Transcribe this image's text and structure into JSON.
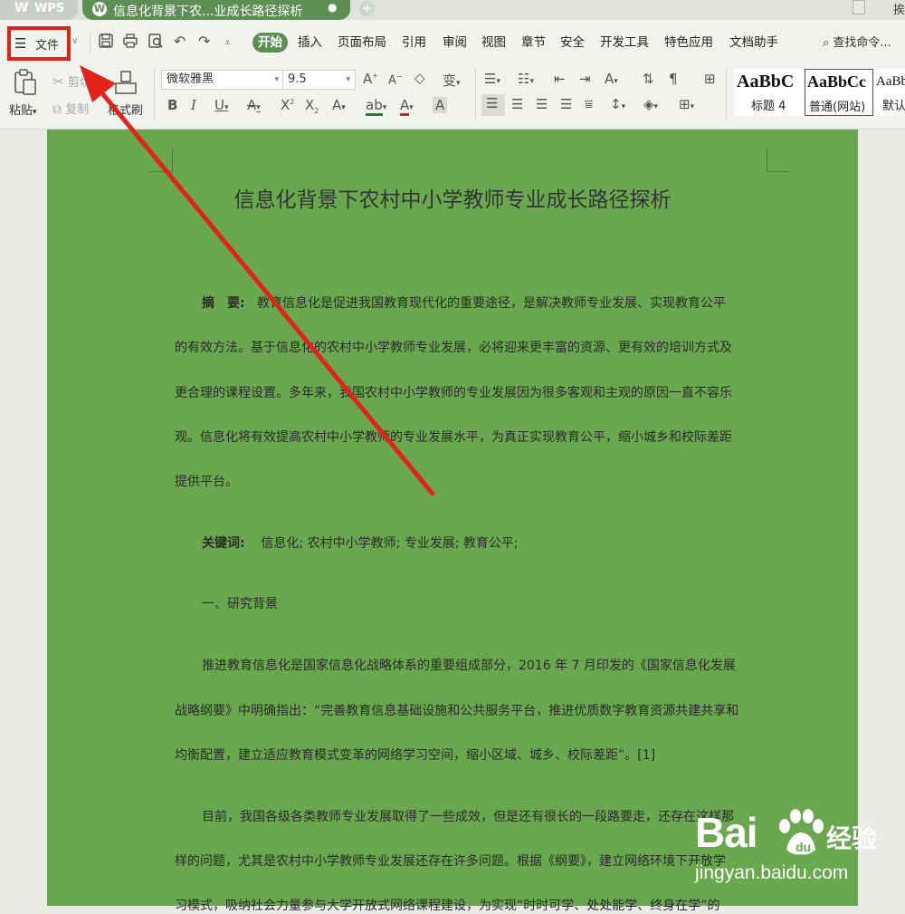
{
  "tabs": {
    "app_tab_label": "WPS",
    "doc_tab_title": "信息化背景下农...业成长路径探析",
    "doc_tab_modified_marker": "●",
    "new_tab_symbol": "+",
    "right_partial_text": "挨"
  },
  "menu": {
    "file_label": "文件",
    "ribbon_tabs": [
      "开始",
      "插入",
      "页面布局",
      "引用",
      "审阅",
      "视图",
      "章节",
      "安全",
      "开发工具",
      "特色应用",
      "文档助手"
    ],
    "active_tab": "开始",
    "search_label": "查找命令..."
  },
  "toolbar": {
    "paste_label": "粘贴",
    "cut_label": "剪切",
    "copy_label": "复制",
    "format_painter_label": "格式刷",
    "font_name": "微软雅黑",
    "font_size": "9.5",
    "styles": [
      {
        "sample": "AaBbC",
        "name": "标题 4"
      },
      {
        "sample": "AaBbCc",
        "name": "普通(网站)"
      },
      {
        "sample": "AaBb",
        "name": "默认"
      }
    ]
  },
  "document": {
    "title": "信息化背景下农村中小学教师专业成长路径探析",
    "abstract_label": "摘　要:",
    "abstract_lines": [
      "教育信息化是促进我国教育现代化的重要途径，是解决教师专业发展、实现教育公平",
      "的有效方法。基于信息化的农村中小学教师专业发展，必将迎来更丰富的资源、更有效的培训方式及",
      "更合理的课程设置。多年来，我国农村中小学教师的专业发展因为很多客观和主观的原因一直不容乐",
      "观。信息化将有效提高农村中小学教师的专业发展水平，为真正实现教育公平，缩小城乡和校际差距",
      "提供平台。"
    ],
    "keywords_label": "关键词:",
    "keywords": "信息化; 农村中小学教师; 专业发展; 教育公平;",
    "section1_heading": "一、研究背景",
    "para1_lines": [
      "推进教育信息化是国家信息化战略体系的重要组成部分，2016 年 7 月印发的《国家信息化发展",
      "战略纲要》中明确指出：“完善教育信息基础设施和公共服务平台，推进优质数字教育资源共建共享和",
      "均衡配置，建立适应教育模式变革的网络学习空间，缩小区域、城乡、校际差距”。[1]"
    ],
    "para2_lines": [
      "目前，我国各级各类教师专业发展取得了一些成效，但是还有很长的一段路要走，还存在这样那",
      "样的问题，尤其是农村中小学教师专业发展还存在许多问题。根据《纲要》，建立网络环境下开放学",
      "习模式，吸纳社会力量参与大学开放式网络课程建设，为实现“时时可学、处处能学、终身在学”的"
    ]
  },
  "watermark": {
    "brand_left": "Bai",
    "brand_right": "经验",
    "url": "jingyan.baidu.com"
  },
  "colors": {
    "accent": "#5d8e53",
    "page_background": "#6aa84f",
    "highlight": "#e2231a"
  }
}
